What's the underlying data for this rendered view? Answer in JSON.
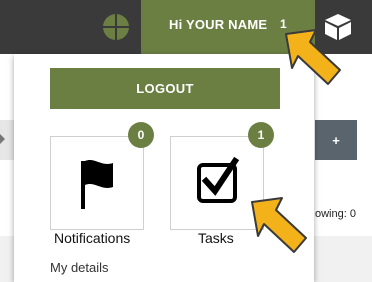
{
  "topbar": {
    "globe_icon": "globe-icon",
    "user_menu": {
      "greeting": "Hi YOUR NAME",
      "count": "1"
    },
    "cube_icon": "cube-icon"
  },
  "background": {
    "plus_label": "+",
    "showing_text": "owing: 0"
  },
  "dropdown": {
    "logout_label": "LOGOUT",
    "tiles": [
      {
        "label": "Notifications",
        "count": "0",
        "icon": "flag-icon"
      },
      {
        "label": "Tasks",
        "count": "1",
        "icon": "checkbox-icon"
      }
    ],
    "details_label": "My details"
  },
  "colors": {
    "accent": "#6b7f43",
    "topbar": "#3a3a3a",
    "arrow": "#f4b21a"
  }
}
